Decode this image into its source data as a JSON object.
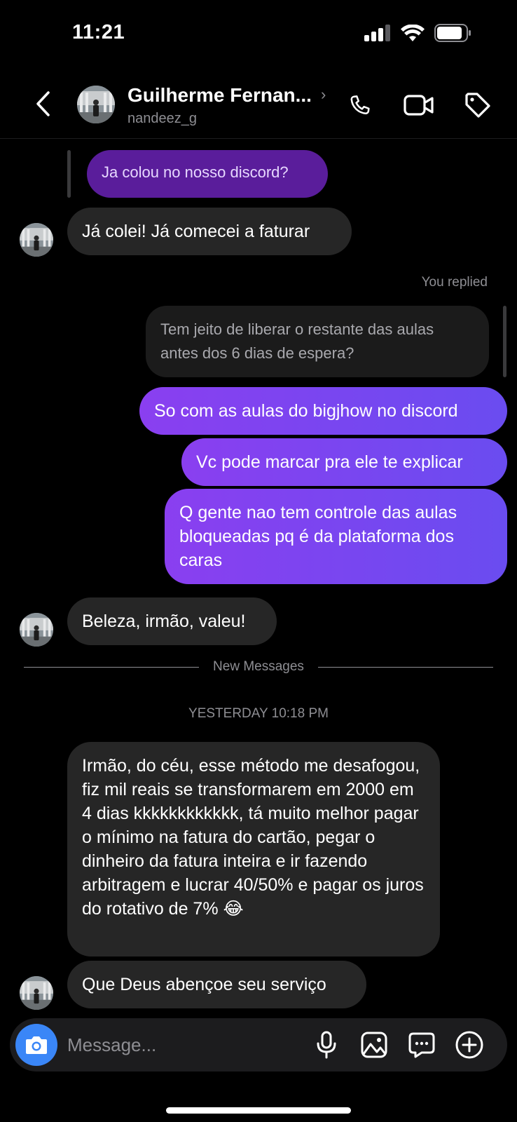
{
  "status_bar": {
    "time": "11:21",
    "battery_level": 0.85
  },
  "header": {
    "contact_name": "Guilherme Fernan...",
    "contact_handle": "nandeez_g",
    "chevron": "›",
    "icons": [
      "back-chevron-icon",
      "phone-icon",
      "video-camera-icon",
      "tag-icon"
    ]
  },
  "messages": [
    {
      "id": "m1",
      "side": "outgoing-reply-quote",
      "text": "Ja colou no nosso discord?"
    },
    {
      "id": "m2",
      "side": "incoming",
      "text": "Já colei! Já comecei a faturar"
    },
    {
      "id": "m3",
      "side": "meta",
      "text": "You replied"
    },
    {
      "id": "m4",
      "side": "incoming-reply-quote",
      "text": "Tem jeito de liberar o restante das aulas antes dos 6 dias de espera?"
    },
    {
      "id": "m5",
      "side": "outgoing",
      "text": "So com as aulas do bigjhow no discord"
    },
    {
      "id": "m6",
      "side": "outgoing",
      "text": "Vc pode marcar pra ele te explicar"
    },
    {
      "id": "m7",
      "side": "outgoing",
      "text": "Q gente nao tem controle das aulas bloqueadas pq é da plataforma dos caras"
    },
    {
      "id": "m8",
      "side": "incoming",
      "text": "Beleza, irmão, valeu!"
    },
    {
      "id": "m9",
      "side": "divider",
      "text": "New Messages"
    },
    {
      "id": "m10",
      "side": "timestamp",
      "text": "YESTERDAY 10:18 PM"
    },
    {
      "id": "m11",
      "side": "incoming",
      "text": "Irmão, do céu, esse método me desafogou, fiz mil reais se transformarem em 2000 em 4 dias kkkkkkkkkkkk, tá muito melhor pagar o mínimo na fatura do cartão, pegar o dinheiro da fatura inteira e ir fazendo arbitragem e lucrar 40/50% e pagar os juros do rotativo de 7% 😂"
    },
    {
      "id": "m12",
      "side": "incoming",
      "text": "Que Deus abençoe seu serviço"
    }
  ],
  "composer": {
    "placeholder": "Message...",
    "icons": [
      "camera-icon",
      "microphone-icon",
      "gallery-icon",
      "sticker-icon",
      "plus-circle-icon"
    ]
  },
  "colors": {
    "background": "#000000",
    "incoming_bubble": "#262626",
    "outgoing_gradient_start": "#8a3ff0",
    "outgoing_gradient_end": "#6a4cf0",
    "camera_button": "#3a86f7"
  }
}
